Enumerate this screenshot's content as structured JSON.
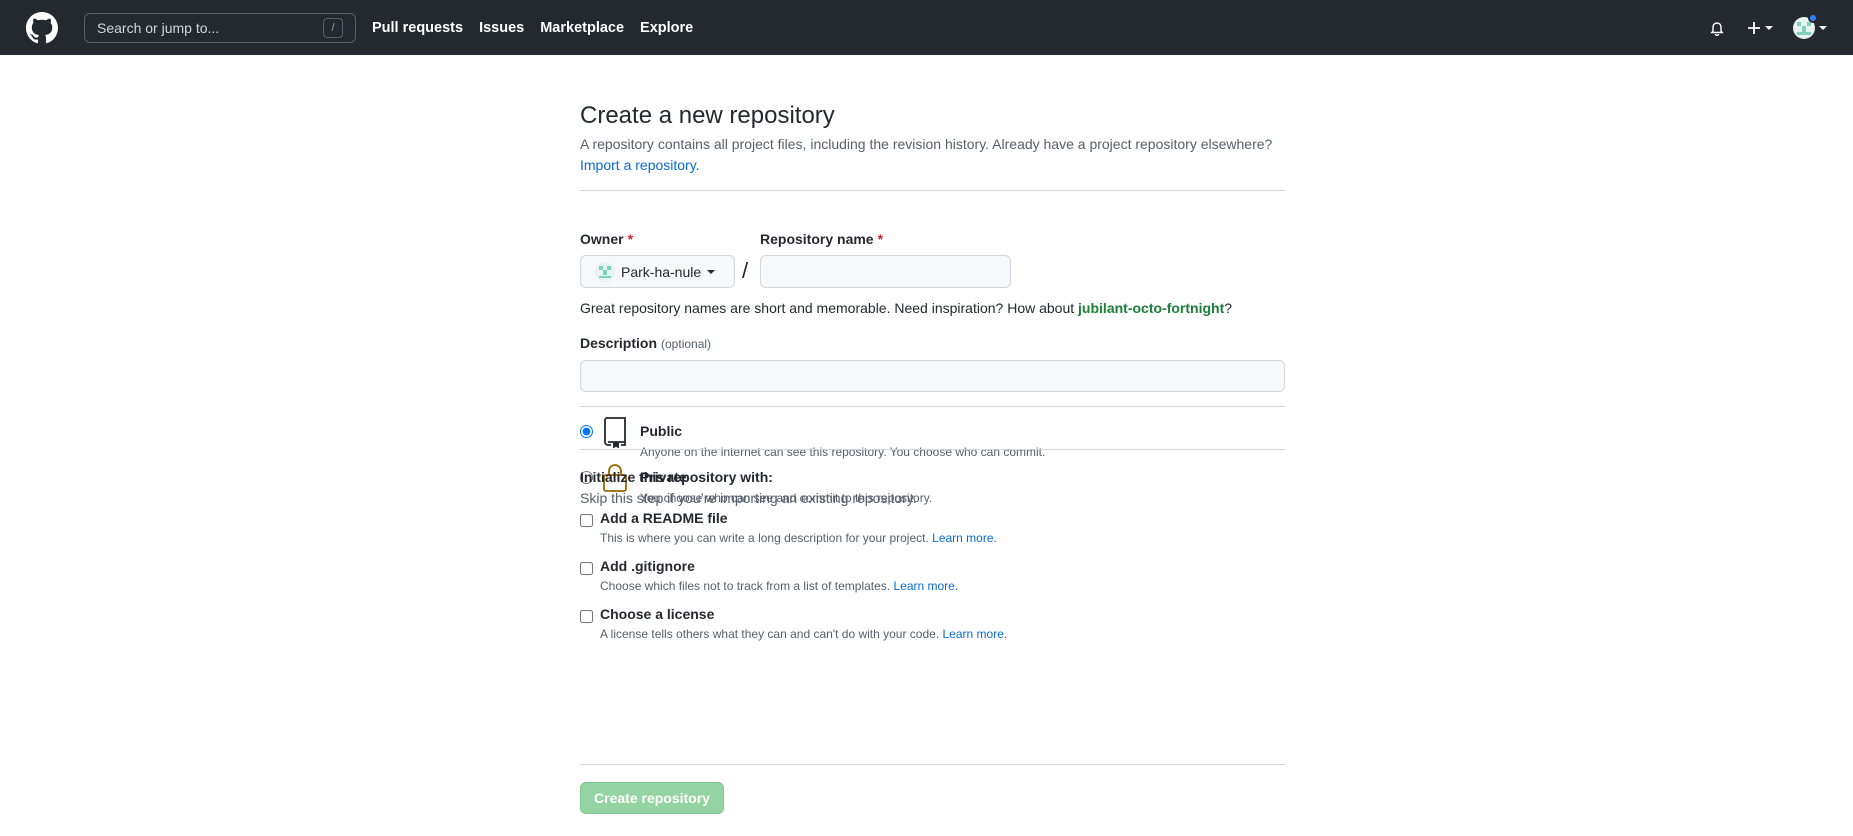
{
  "header": {
    "search_placeholder": "Search or jump to...",
    "search_shortcut": "/",
    "nav": [
      "Pull requests",
      "Issues",
      "Marketplace",
      "Explore"
    ],
    "notification_dot_color": "#2f81f7"
  },
  "page": {
    "title": "Create a new repository",
    "subtitle": "A repository contains all project files, including the revision history. Already have a project repository elsewhere?",
    "import_link": "Import a repository."
  },
  "form": {
    "owner_label": "Owner",
    "owner_value": "Park-ha-nule",
    "repo_name_label": "Repository name",
    "required_marker": "*",
    "separator": "/",
    "repo_name_value": "",
    "hint_prefix": "Great repository names are short and memorable. Need inspiration? How about ",
    "hint_suggestion": "jubilant-octo-fortnight",
    "hint_suffix": "?",
    "description_label": "Description",
    "description_optional": "(optional)",
    "description_value": ""
  },
  "visibility": {
    "selected": "public",
    "public_title": "Public",
    "public_desc": "Anyone on the internet can see this repository. You choose who can commit.",
    "private_title": "Private",
    "private_desc": "You choose who can see and commit to this repository."
  },
  "initialize": {
    "title": "Initialize this repository with:",
    "subtitle": "Skip this step if you’re importing an existing repository.",
    "readme_title": "Add a README file",
    "readme_desc": "This is where you can write a long description for your project. ",
    "gitignore_title": "Add .gitignore",
    "gitignore_desc": "Choose which files not to track from a list of templates. ",
    "license_title": "Choose a license",
    "license_desc": "A license tells others what they can and can't do with your code. ",
    "learn_more": "Learn more."
  },
  "submit_label": "Create repository",
  "colors": {
    "header_bg": "#24292f",
    "link": "#0969da",
    "suggestion": "#1a7f37",
    "required": "#cf222e",
    "submit_disabled": "#94d3a2",
    "private_lock": "#9a6700"
  }
}
